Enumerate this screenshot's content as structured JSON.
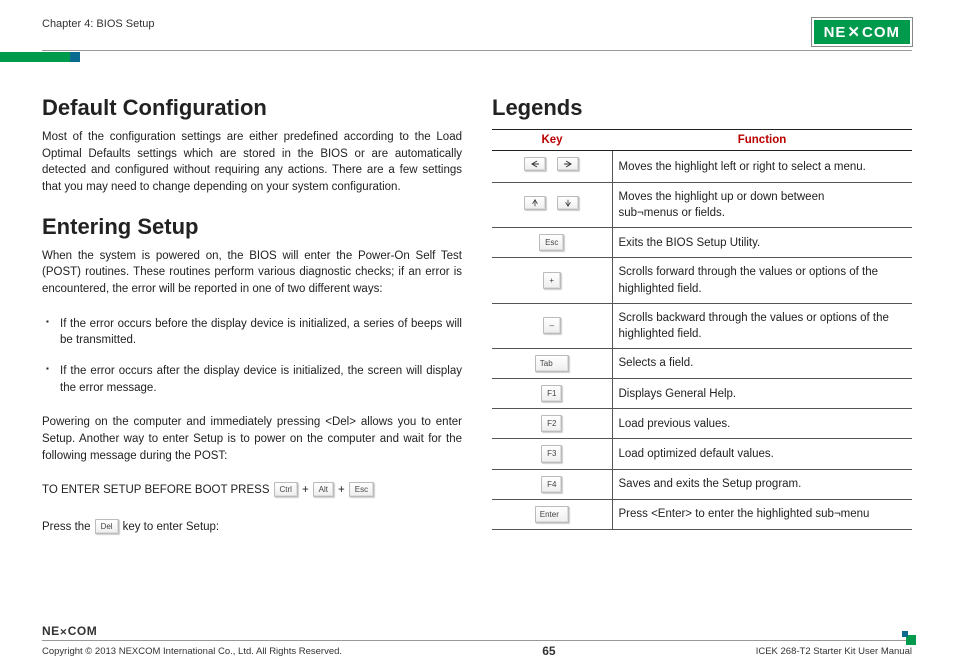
{
  "header": {
    "chapter": "Chapter 4: BIOS Setup",
    "brand": "NEXCOM"
  },
  "left": {
    "h1a": "Default Configuration",
    "p1": "Most of the configuration settings are either predefined according to the Load Optimal Defaults settings which are stored in the BIOS or are automatically detected and configured without requiring any actions. There are a few settings that you may need to change depending on your system configuration.",
    "h1b": "Entering Setup",
    "p2": "When the system is powered on, the BIOS will enter the Power-On Self Test (POST) routines. These routines perform various diagnostic checks; if an error is encountered, the error will be reported in one of two different ways:",
    "b1": "If the error occurs before the display device is initialized, a series of beeps will be transmitted.",
    "b2": "If the error occurs after the display device is initialized, the screen will display the error message.",
    "p3": "Powering on the computer and immediately pressing <Del> allows you to enter Setup. Another way to enter Setup is to power on the computer and wait for the following message during the POST:",
    "setup_prefix": "TO ENTER SETUP BEFORE BOOT PRESS",
    "plus": "+",
    "k_ctrl": "Ctrl",
    "k_alt": "Alt",
    "k_esc": "Esc",
    "press_prefix": "Press the",
    "k_del": "Del",
    "press_suffix": "key to enter Setup:"
  },
  "right": {
    "h1": "Legends",
    "th_key": "Key",
    "th_fn": "Function",
    "rows": {
      "r1": "Moves the highlight left or right to select a menu.",
      "r2a": "Moves the highlight up or down between",
      "r2b": "sub¬menus or fields.",
      "r3": "Exits the BIOS Setup Utility.",
      "r4": "Scrolls forward through the values or options of the highlighted field.",
      "r5": "Scrolls backward through the values or options of the highlighted field.",
      "r6": "Selects a field.",
      "r7": "Displays General Help.",
      "r8": "Load previous values.",
      "r9": "Load optimized default values.",
      "r10": "Saves and exits the Setup program.",
      "r11": "Press <Enter> to enter the highlighted sub¬menu"
    },
    "keys": {
      "esc": "Esc",
      "plus": "+",
      "minus": "–",
      "tab": "Tab",
      "f1": "F1",
      "f2": "F2",
      "f3": "F3",
      "f4": "F4",
      "enter": "Enter"
    }
  },
  "footer": {
    "brand": "NE COM",
    "copyright": "Copyright © 2013 NEXCOM International Co., Ltd. All Rights Reserved.",
    "page": "65",
    "manual": "ICEK 268-T2 Starter Kit User Manual"
  }
}
